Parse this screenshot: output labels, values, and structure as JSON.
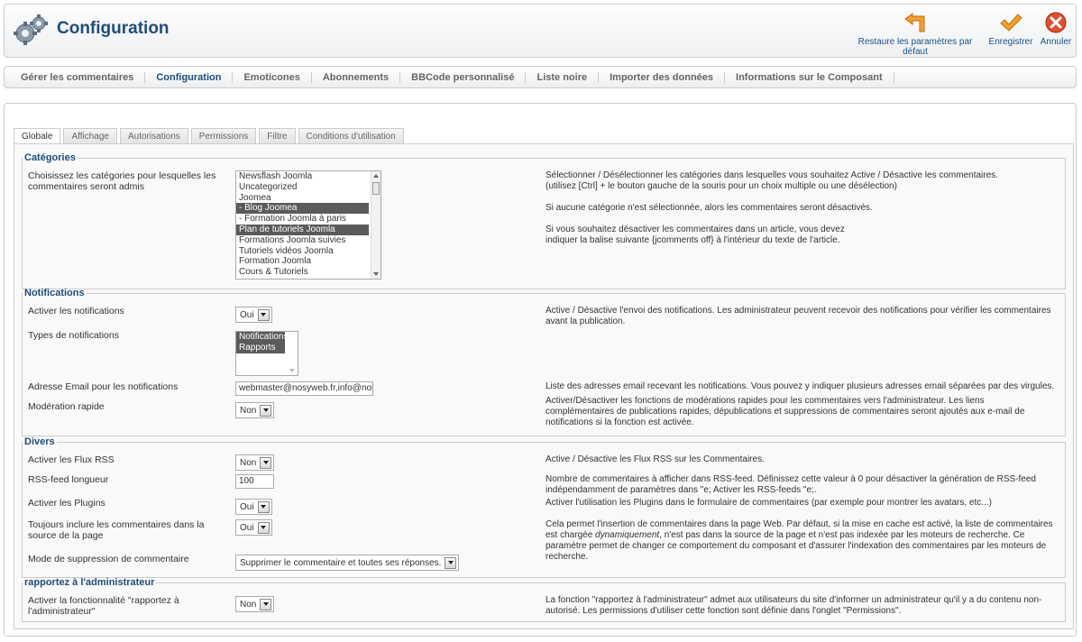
{
  "header": {
    "title": "Configuration",
    "logo_icon": "gears-icon",
    "toolbar": {
      "restore_label": "Restaure les paramètres par défaut",
      "save_label": "Enregistrer",
      "cancel_label": "Annuler"
    }
  },
  "submenu": [
    "Gérer les commentaires",
    "Configuration",
    "Emoticones",
    "Abonnements",
    "BBCode personnalisé",
    "Liste noire",
    "Importer des données",
    "Informations sur le Composant"
  ],
  "submenu_active": "Configuration",
  "tabs": [
    "Globale",
    "Affichage",
    "Autorisations",
    "Permissions",
    "Filtre",
    "Conditions d'utilisation"
  ],
  "tabs_active": "Globale",
  "categories": {
    "legend": "Catégories",
    "label": "Choisissez les catégories pour lesquelles les commentaires seront admis",
    "options": [
      {
        "text": "Newsflash Joomla",
        "selected": false
      },
      {
        "text": "Uncategorized",
        "selected": false
      },
      {
        "text": "Joomea",
        "selected": false
      },
      {
        "text": "- Blog Joomea",
        "selected": true
      },
      {
        "text": "- Formation Joomla à paris",
        "selected": false
      },
      {
        "text": "Plan de tutoriels Joomla",
        "selected": true
      },
      {
        "text": "Formations Joomla suivies",
        "selected": false
      },
      {
        "text": "Tutoriels vidéos Joomla",
        "selected": false
      },
      {
        "text": "Formation Joomla",
        "selected": false
      },
      {
        "text": "Cours & Tutoriels",
        "selected": false
      }
    ],
    "desc1": "Sélectionner / Désélectionner les catégories dans lesquelles vous souhaitez Active / Désactive les commentaires.",
    "desc2": "(utilisez [Ctrl] + le bouton gauche de la souris pour un choix multiple ou une désélection)",
    "desc3": "Si aucune catégorie n'est sélectionnée, alors les commentaires seront désactivés.",
    "desc4": "Si vous souhaitez désactiver les commentaires dans un article, vous devez",
    "desc5": "indiquer la balise suivante {jcomments off} à l'intérieur du texte de l'article."
  },
  "notifications": {
    "legend": "Notifications",
    "enable_label": "Activer les notifications",
    "enable_value": "Oui",
    "enable_desc": "Active / Désactive l'envoi des notifications. Les administrateur peuvent recevoir des notifications pour vérifier les commentaires avant la publication.",
    "types_label": "Types de notifications",
    "types_options": [
      {
        "text": "Notifications",
        "selected": true
      },
      {
        "text": "Rapports",
        "selected": true
      }
    ],
    "email_label": "Adresse Email pour les notifications",
    "email_value": "webmaster@nosyweb.fr,info@nosyweb.fr",
    "email_desc": "Liste des adresses email recevant les notifications. Vous pouvez y indiquer plusieurs adresses email séparées par des virgules.",
    "moderation_label": "Modération rapide",
    "moderation_value": "Non",
    "moderation_desc": "Activer/Désactiver les fonctions de modérations rapides pour les commentaires vers l'administrateur. Les liens complémentaires de publications rapides, dépublications et suppressions de commentaires seront ajoutés aux e-mail de notifications si la fonction est activée."
  },
  "divers": {
    "legend": "Divers",
    "rss_label": "Activer les Flux RSS",
    "rss_value": "Non",
    "rss_desc": "Active / Désactive les Flux RSS sur les Commentaires.",
    "rss_length_label": "RSS-feed longueur",
    "rss_length_value": "100",
    "rss_length_desc": "Nombre de commentaires à afficher dans RSS-feed. Définissez cette valeur à 0 pour désactiver la génération de RSS-feed indépendamment de paramètres dans \"e; Activer les RSS-feeds \"e;.",
    "plugins_label": "Activer les Plugins",
    "plugins_value": "Oui",
    "plugins_desc": "Activer l'utilisation les Plugins dans le formulaire de commentaires (par exemple pour montrer les avatars, etc...)",
    "source_label": "Toujours inclure les commentaires dans la source de la page",
    "source_value": "Oui",
    "source_desc_1": "Cela permet l'insertion de commentaires dans la page Web. Par défaut, si la mise en cache est activé, la liste de commentaires est chargée ",
    "source_desc_em": "dynamiquement",
    "source_desc_2": ", n'est pas dans la source de la page et n'est pas indexée par les moteurs de recherche. Ce paramètre permet de changer ce comportement du composant et d'assurer l'indexation des commentaires par les moteurs de recherche.",
    "delete_label": "Mode de suppression de commentaire",
    "delete_value": "Supprimer le commentaire et toutes ses réponses."
  },
  "report": {
    "legend": "rapportez à l'administrateur",
    "label": "Activer la fonctionnalité \"rapportez à l'administrateur\"",
    "value": "Non",
    "desc": "La fonction \"rapportez à l'administrateur\" admet aux utilisateurs du site d'informer un administrateur qu'il y a du contenu non-autorisé. Les permissions d'utiliser cette fonction sont définie dans l'onglet \"Permissions\"."
  },
  "colors": {
    "title": "#1e4d7a",
    "restore_icon": "#f0a030",
    "save_icon": "#f0a030",
    "cancel_icon": "#e05030",
    "selected_option": "#5a5a5a"
  }
}
